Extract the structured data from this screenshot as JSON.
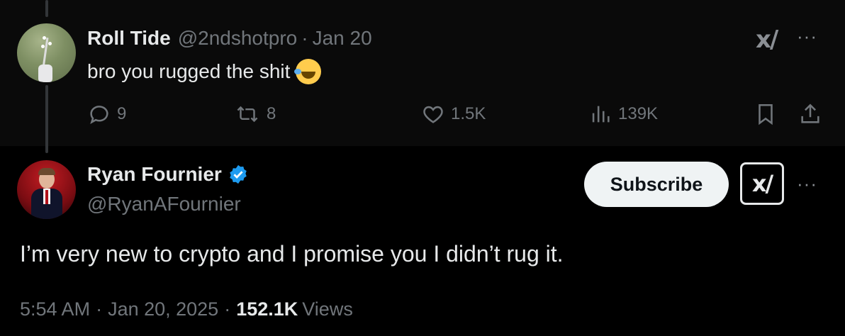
{
  "reply": {
    "author_name": "Roll Tide",
    "handle": "@2ndshotpro",
    "separator": "·",
    "date": "Jan 20",
    "text": "bro you rugged the shit",
    "emoji": "rolling-on-floor-laughing",
    "xai_logo": "x/",
    "more": "···",
    "actions": {
      "replies": "9",
      "reposts": "8",
      "likes": "1.5K",
      "views": "139K"
    }
  },
  "main": {
    "author_name": "Ryan Fournier",
    "handle": "@RyanAFournier",
    "verified": true,
    "subscribe_label": "Subscribe",
    "xai_logo": "x/",
    "more": "···",
    "text": "I’m very new to crypto and I promise you I didn’t rug it.",
    "time": "5:54 AM",
    "separator": "·",
    "date": "Jan 20, 2025",
    "views_count": "152.1K",
    "views_label": "Views"
  },
  "colors": {
    "background": "#000000",
    "reply_background": "#0a0a0a",
    "text": "#e7e9ea",
    "muted": "#71767b",
    "verified": "#1d9bf0",
    "subscribe_bg": "#eff3f4"
  }
}
